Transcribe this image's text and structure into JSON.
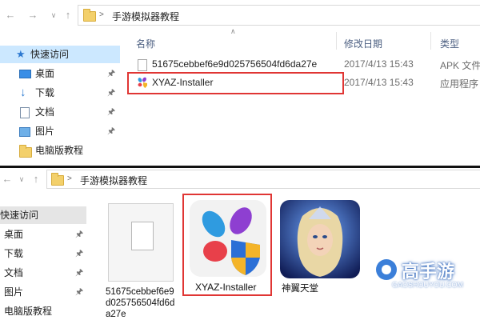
{
  "top_window": {
    "address": {
      "separator": ">",
      "path": "手游模拟器教程"
    },
    "columns": {
      "name": "名称",
      "modified": "修改日期",
      "type": "类型"
    },
    "sidebar": {
      "items": [
        {
          "label": "快速访问",
          "icon": "star-icon"
        },
        {
          "label": "桌面",
          "icon": "desktop-icon"
        },
        {
          "label": "下载",
          "icon": "download-icon"
        },
        {
          "label": "文档",
          "icon": "documents-icon"
        },
        {
          "label": "图片",
          "icon": "pictures-icon"
        },
        {
          "label": "电脑版教程",
          "icon": "folder-icon"
        }
      ]
    },
    "files": [
      {
        "name": "51675cebbef6e9d025756504fd6da27e",
        "modified": "2017/4/13 15:43",
        "type": "APK 文件"
      },
      {
        "name": "XYAZ-Installer",
        "modified": "2017/4/13 15:43",
        "type": "应用程序"
      }
    ]
  },
  "bottom_window": {
    "address": {
      "separator": ">",
      "path": "手游模拟器教程"
    },
    "sidebar": {
      "items": [
        {
          "label": "快速访问"
        },
        {
          "label": "桌面"
        },
        {
          "label": "下载"
        },
        {
          "label": "文档"
        },
        {
          "label": "图片"
        },
        {
          "label": "电脑版教程"
        }
      ]
    },
    "tiles": [
      {
        "caption": "51675cebbef6e9d025756504fd6da27e",
        "icon": "blank-file-icon"
      },
      {
        "caption": "XYAZ-Installer",
        "icon": "xyaz-app-icon"
      },
      {
        "caption": "神翼天堂",
        "icon": "game-app-icon"
      }
    ]
  },
  "watermark": {
    "brand": "高手游",
    "site": "GAOSHOUYOU.COM"
  },
  "colors": {
    "highlight_red": "#e03634",
    "selected_bg": "#cce8ff",
    "header_text": "#4d6082"
  }
}
